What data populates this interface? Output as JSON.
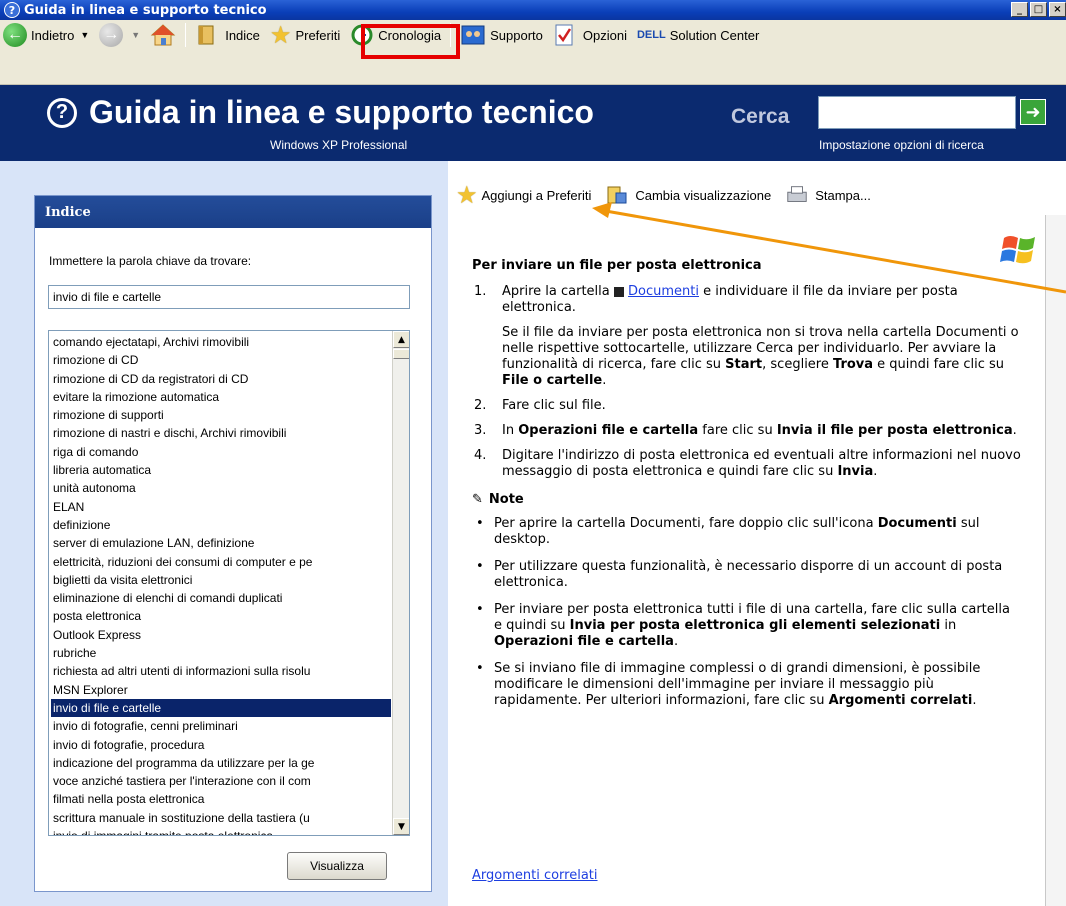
{
  "window": {
    "title": "Guida in linea e supporto tecnico",
    "controls": [
      "_",
      "□",
      "×"
    ]
  },
  "toolbar": {
    "back_label": "Indietro",
    "index_label": "Indice",
    "favorites_label": "Preferiti",
    "history_label": "Cronologia",
    "support_label": "Supporto",
    "options_label": "Opzioni",
    "dell_label": "DELL",
    "solution_label": "Solution Center"
  },
  "banner": {
    "title": "Guida in linea e supporto tecnico",
    "subtitle": "Windows XP Professional",
    "search_label": "Cerca",
    "search_value": "",
    "search_options": "Impostazione opzioni di ricerca"
  },
  "index": {
    "header": "Indice",
    "prompt": "Immettere la parola chiave da trovare:",
    "input_value": "invio di file e cartelle",
    "items": [
      "comando ejectatapi, Archivi rimovibili",
      "rimozione di CD",
      "rimozione di CD da registratori di CD",
      "evitare la rimozione automatica",
      "rimozione di supporti",
      "rimozione di nastri e dischi, Archivi rimovibili",
      "riga di comando",
      "libreria automatica",
      "unità autonoma",
      "ELAN",
      "definizione",
      "server di emulazione LAN, definizione",
      "elettricità, riduzioni dei consumi di computer e pe",
      "biglietti da visita elettronici",
      "eliminazione di elenchi di comandi duplicati",
      "posta elettronica",
      "Outlook Express",
      "rubriche",
      "richiesta ad altri utenti di informazioni sulla risolu",
      "MSN Explorer",
      "invio di file e cartelle",
      "invio di fotografie, cenni preliminari",
      "invio di fotografie, procedura",
      "indicazione del programma da utilizzare per la ge",
      "voce anziché tastiera per l'interazione con il com",
      "filmati nella posta elettronica",
      "scrittura manuale in sostituzione della tastiera (u",
      "invio di immagini tramite posta elettronica"
    ],
    "selected_index": 20,
    "show_button": "Visualizza"
  },
  "content_toolbar": {
    "add_favorites": "Aggiungi a Preferiti",
    "change_view": "Cambia visualizzazione",
    "print": "Stampa..."
  },
  "article": {
    "title": "Per inviare un file per posta elettronica",
    "step1_num": "1.",
    "step1_a": "Aprire la cartella",
    "step1_link": "Documenti",
    "step1_b": "e individuare il file da inviare per posta elettronica.",
    "step1_p2_a": "Se il file da inviare per posta elettronica non si trova nella cartella Documenti o nelle rispettive sottocartelle, utilizzare Cerca per individuarlo. Per avviare la funzionalità di ricerca, fare clic su",
    "step1_p2_start": "Start",
    "step1_p2_b": ", scegliere",
    "step1_p2_trova": "Trova",
    "step1_p2_c": "e quindi fare clic su",
    "step1_p2_file": "File o cartelle",
    "step2_num": "2.",
    "step2": "Fare clic sul file.",
    "step3_num": "3.",
    "step3_a": "In",
    "step3_b": "Operazioni file e cartella",
    "step3_c": "fare clic su",
    "step3_d": "Invia il file per posta elettronica",
    "step4_num": "4.",
    "step4_a": "Digitare l'indirizzo di posta elettronica ed eventuali altre informazioni nel nuovo messaggio di posta elettronica e quindi fare clic su",
    "step4_b": "Invia",
    "notes_title": "Note",
    "note1_a": "Per aprire la cartella Documenti, fare doppio clic sull'icona",
    "note1_b": "Documenti",
    "note1_c": "sul desktop.",
    "note2": "Per utilizzare questa funzionalità, è necessario disporre di un account di posta elettronica.",
    "note3_a": "Per inviare per posta elettronica tutti i file di una cartella, fare clic sulla cartella e quindi su",
    "note3_b": "Invia per posta elettronica gli elementi selezionati",
    "note3_c": "in",
    "note3_d": "Operazioni file e cartella",
    "note4_a": "Se si inviano file di immagine complessi o di grandi dimensioni, è possibile modificare le dimensioni dell'immagine per inviare il messaggio più rapidamente. Per ulteriori informazioni, fare clic su",
    "note4_b": "Argomenti correlati",
    "related_link": "Argomenti correlati"
  },
  "colors": {
    "banner": "#0b2a6f",
    "highlight": "#e60000",
    "arrow": "#f0960a",
    "selection": "#0a246a"
  }
}
